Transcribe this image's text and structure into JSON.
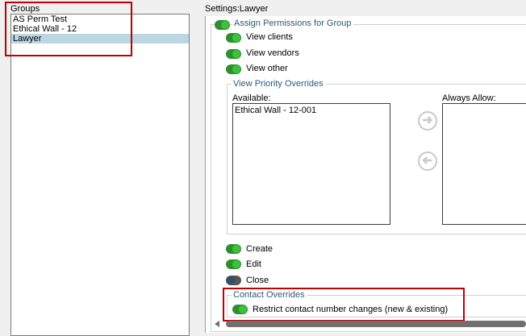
{
  "groups": {
    "title": "Groups",
    "items": [
      {
        "label": "AS Perm Test",
        "selected": false
      },
      {
        "label": "Ethical Wall - 12",
        "selected": false
      },
      {
        "label": "Lawyer",
        "selected": true
      }
    ]
  },
  "settings": {
    "title": "Settings:Lawyer",
    "assign_permissions": {
      "legend": "Assign Permissions for Group",
      "enabled": true,
      "view_clients": {
        "label": "View clients",
        "on": true
      },
      "view_vendors": {
        "label": "View vendors",
        "on": true
      },
      "view_other": {
        "label": "View other",
        "on": true
      }
    },
    "priority_overrides": {
      "legend": "View Priority Overrides",
      "available_label": "Available:",
      "available_items": [
        "Ethical Wall - 12-001"
      ],
      "always_allow_label": "Always Allow:",
      "always_allow_items": [],
      "add_icon": "arrow-right-icon",
      "remove_icon": "arrow-left-icon"
    },
    "create": {
      "label": "Create",
      "on": true
    },
    "edit": {
      "label": "Edit",
      "on": true
    },
    "close": {
      "label": "Close",
      "on": false
    },
    "contact_overrides": {
      "legend": "Contact Overrides",
      "restrict": {
        "label": "Restrict contact number changes (new & existing)",
        "on": true
      }
    }
  },
  "colors": {
    "toggle_on": "#3bc43b",
    "toggle_off": "#2f4f6f",
    "highlight_box": "#c00000",
    "selected_row": "#bcd6e4",
    "legend_text": "#2b5a7c"
  }
}
